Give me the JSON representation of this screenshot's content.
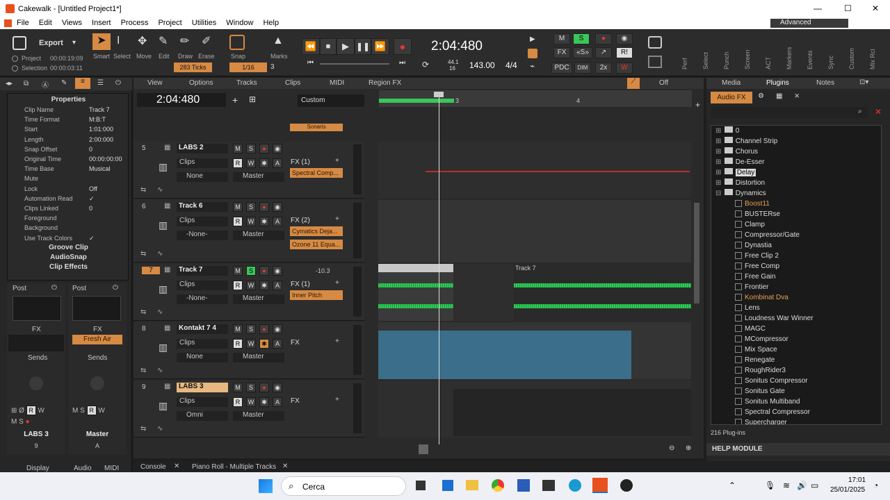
{
  "window": {
    "title": "Cakewalk - [Untitled Project1*]",
    "controls": [
      "—",
      "☐",
      "✕"
    ]
  },
  "menu": [
    "File",
    "Edit",
    "Views",
    "Insert",
    "Process",
    "Project",
    "Utilities",
    "Window",
    "Help"
  ],
  "workspace": {
    "label": "Advanced"
  },
  "control_bar": {
    "export": "Export",
    "project_label": "Project",
    "project_time": "00:00:19:09",
    "selection_label": "Selection",
    "selection_time": "00:00:03:11",
    "tools": [
      "Smart",
      "Select",
      "Move",
      "Edit",
      "Draw",
      "Erase"
    ],
    "snap": "Snap",
    "marks": "Marks",
    "snap_value": "283 Ticks",
    "snap_res": "1/16",
    "snap_num": "3",
    "time": "2:04:480",
    "sample_rate": "44.1",
    "bit_depth": "16",
    "tempo": "143.00",
    "meter": "4/4",
    "mix": {
      "m": "M",
      "s": "S",
      "fx": "FX",
      "pdc": "PDC",
      "dim": "DIM",
      "x2": "2x",
      "r": "R!",
      "w": "W"
    },
    "vert_labels": [
      "Perf",
      "Select",
      "Punch",
      "Screen",
      "ACT",
      "Markers",
      "Events",
      "Sync",
      "Custom",
      "Mix Rcl"
    ]
  },
  "inspector": {
    "title": "Properties",
    "props": [
      [
        "Clip Name",
        "Track 7"
      ],
      [
        "Time Format",
        "M:B:T"
      ],
      [
        "Start",
        "1:01:000"
      ],
      [
        "Length",
        "2:00:000"
      ],
      [
        "Snap Offset",
        "0"
      ],
      [
        "Original Time",
        "00:00:00:00"
      ],
      [
        "Time Base",
        "Musical"
      ],
      [
        "Mute",
        ""
      ],
      [
        "Lock",
        "Off"
      ],
      [
        "Automation Read",
        "✓"
      ],
      [
        "Clips Linked",
        "0"
      ],
      [
        "Foreground",
        ""
      ],
      [
        "Background",
        ""
      ],
      [
        "Use Track Colors",
        "✓"
      ]
    ],
    "sections": [
      "Groove Clip",
      "AudioSnap",
      "Clip Effects"
    ],
    "strip1": {
      "post": "Post",
      "fx": "FX",
      "sends": "Sends",
      "name": "LABS 3",
      "num": "9"
    },
    "strip2": {
      "post": "Post",
      "fx": "FX",
      "fx_plugin": "Fresh Air",
      "sends": "Sends",
      "name": "Master",
      "num": "A"
    },
    "bottom_tabs": [
      "Display",
      "Audio",
      "MIDI"
    ]
  },
  "trackview": {
    "menus": [
      "View",
      "Options",
      "Tracks",
      "Clips",
      "MIDI",
      "Region FX"
    ],
    "off": "Off",
    "now_time": "2:04:480",
    "custom": "Custom",
    "ruler": [
      "3",
      "4"
    ],
    "top_plugin": "Sonaris",
    "tracks": [
      {
        "num": "5",
        "name": "LABS 2",
        "mode1": "Clips",
        "input": "None",
        "output": "Master",
        "fx": "FX (1)",
        "plugins": [
          "Spectral Comp..."
        ]
      },
      {
        "num": "6",
        "name": "Track 6",
        "mode1": "Clips",
        "input": "-None-",
        "output": "Master",
        "fx": "FX (2)",
        "plugins": [
          "Cymatics Deja...",
          "Ozone 11 Equa..."
        ]
      },
      {
        "num": "7",
        "name": "Track 7",
        "mode1": "Clips",
        "input": "-None-",
        "output": "Master",
        "fx": "FX (1)",
        "plugins": [
          "Inner Pitch"
        ],
        "vol": "-10.3",
        "clip": "Track 7"
      },
      {
        "num": "8",
        "name": "Kontakt 7 4",
        "mode1": "Clips",
        "input": "None",
        "output": "Master",
        "fx": "FX",
        "plugins": []
      },
      {
        "num": "9",
        "name": "LABS 3",
        "mode1": "Clips",
        "input": "Omni",
        "output": "Master",
        "fx": "FX",
        "plugins": []
      }
    ]
  },
  "browser": {
    "tabs": [
      "Media",
      "Plugins",
      "Notes"
    ],
    "subtab": "Audio FX",
    "items": [
      "0",
      "Channel Strip",
      "Chorus",
      "De-Esser",
      "Delay",
      "Distortion",
      "Dynamics"
    ],
    "plugins": [
      "Boost11",
      "BUSTERse",
      "Clamp",
      "Compressor/Gate",
      "Dynastia",
      "Free Clip 2",
      "Free Comp",
      "Free Gain",
      "Frontier",
      "Kombinat Dva",
      "Lens",
      "Loudness War Winner",
      "MAGC",
      "MCompressor",
      "Mix Space",
      "Renegate",
      "RoughRider3",
      "Sonitus Compressor",
      "Sonitus Gate",
      "Sonitus Multiband",
      "Spectral Compressor",
      "Supercharger"
    ],
    "count": "216 Plug-ins",
    "help": "HELP MODULE"
  },
  "doc_tabs": [
    "Console",
    "Piano Roll - Multiple Tracks"
  ],
  "taskbar": {
    "search": "Cerca",
    "time": "17:01",
    "date": "25/01/2025"
  }
}
